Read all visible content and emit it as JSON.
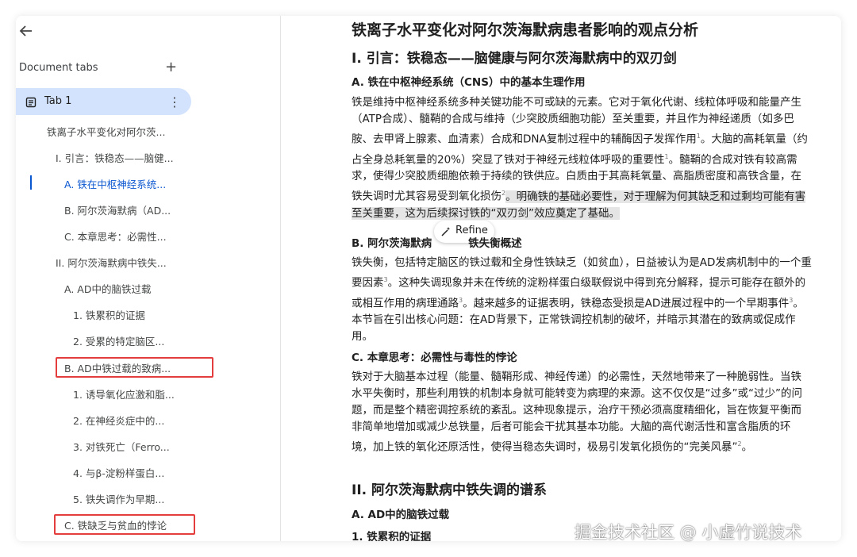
{
  "sidebar": {
    "section_title": "Document tabs",
    "add_label": "+",
    "tab": {
      "label": "Tab 1",
      "more": "⋮"
    },
    "toc": [
      "铁离子水平变化对阿尔茨...",
      "I. 引言：铁稳态——脑健...",
      "A. 铁在中枢神经系统...",
      "B. 阿尔茨海默病（AD...",
      "C. 本章思考：必需性...",
      "II. 阿尔茨海默病中铁失...",
      "A. AD中的脑铁过载",
      "1. 铁累积的证据",
      "2. 受累的特定脑区...",
      "B. AD中铁过载的致病...",
      "1. 诱导氧化应激和脂...",
      "2. 在神经炎症中的...",
      "3. 对铁死亡（Ferro...",
      "4. 与β-淀粉样蛋白...",
      "5. 铁失调作为早期...",
      "C. 铁缺乏与贫血的悖论"
    ]
  },
  "doc": {
    "title": "铁离子水平变化对阿尔茨海默病患者影响的观点分析",
    "section1": "I. 引言：铁稳态——脑健康与阿尔茨海默病中的双刃剑",
    "subA": "A. 铁在中枢神经系统（CNS）中的基本生理作用",
    "paraA_pre": "铁是维持中枢神经系统多种关键功能不可或缺的元素。它对于氧化代谢、线粒体呼吸和能量产生（ATP合成）、髓鞘的合成与维持（少突胶质细胞功能）至关重要，并且作为神经递质（如多巴胺、去甲肾上腺素、血清素）合成和DNA复制过程中的辅酶因子发挥作用",
    "paraA_mid": "。大脑的高耗氧量（约占全身总耗氧量的20%）突显了铁对于神经元线粒体呼吸的重要性",
    "paraA_mid2": "。髓鞘的合成对铁有较高需求，使得少突胶质细胞依赖于持续的铁供应。白质由于其高耗氧量、高脂质密度和高铁含量，在铁失调时尤其容易受到氧化损伤",
    "paraA_hl_pre": "。明确铁的基础",
    "paraA_hl": "必要性，对于理解为何其缺乏和过剩均可能有害至关重要，这为后续探讨铁的“双刃剑”效应奠定了基础。",
    "subB_left": "B. 阿尔茨海默病",
    "subB_right": "铁失衡概述",
    "paraB1": "铁失衡，包括特定脑区的铁过载和全身性铁缺乏（如贫血），日益被认为是AD发病机制中的一个重要因素",
    "paraB2": "。这种失调现象并未在传统的淀粉样蛋白级联假说中得到充分解释，提示可能存在额外的或相互作用的病理通路",
    "paraB3": "。越来越多的证据表明，铁稳态受损是AD进展过程中的一个早期事件",
    "paraB4": "。本节旨在引出核心问题：在AD背景下，正常铁调控机制的破坏，并暗示其潜在的致病或促成作用。",
    "subC": "C. 本章思考：必需性与毒性的悖论",
    "paraC": "铁对于大脑基本过程（能量、髓鞘形成、神经传递）的必需性，天然地带来了一种脆弱性。当铁水平失衡时，那些利用铁的机制本身就可能转变为病理的来源。这不仅仅是“过多”或“过少”的问题，而是整个精密调控系统的紊乱。这种现象提示，治疗干预必须高度精细化，旨在恢复平衡而非简单地增加或减少总铁量，后者可能会干扰其基本功能。大脑的高代谢活性和富含脂质的环境，加上铁的氧化还原活性，使得当稳态失调时，极易引发氧化损伤的“完美风暴”",
    "section2": "II. 阿尔茨海默病中铁失调的谱系",
    "subIIA": "A. AD中的脑铁过载",
    "subII1": "1. 铁累积的证据",
    "refs": {
      "r1": "1",
      "r2": "2",
      "r3": "3"
    }
  },
  "refine": {
    "label": "Refine"
  },
  "watermark": "掘金技术社区 @ 小虚竹说技术"
}
